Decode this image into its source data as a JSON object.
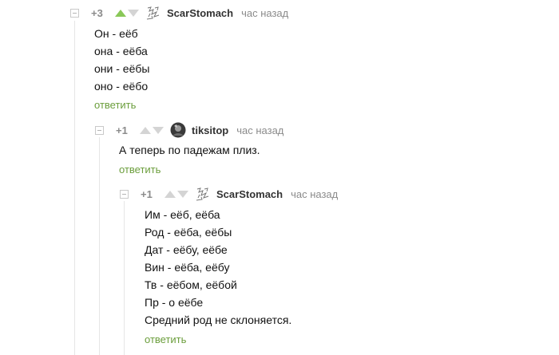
{
  "comments": [
    {
      "rating": "+3",
      "user": "ScarStomach",
      "time": "час назад",
      "lines": [
        "Он - еёб",
        "она - еёба",
        "они - еёбы",
        "оно - еёбо"
      ],
      "reply": "ответить",
      "upvote_active": true,
      "avatar_icon": "scribble-avatar-icon"
    },
    {
      "rating": "+1",
      "user": "tiksitop",
      "time": "час назад",
      "lines": [
        "А теперь по падежам плиз."
      ],
      "reply": "ответить",
      "upvote_active": false,
      "avatar_icon": "photo-avatar-icon"
    },
    {
      "rating": "+1",
      "user": "ScarStomach",
      "time": "час назад",
      "lines": [
        "Им - еёб, еёба",
        "Род - еёба, еёбы",
        "Дат - еёбу, еёбе",
        "Вин - еёба, еёбу",
        "Тв - еёбом, еёбой",
        "Пр - о еёбе",
        "Средний род не склоняется."
      ],
      "reply": "ответить",
      "upvote_active": false,
      "avatar_icon": "scribble-avatar-icon"
    }
  ],
  "colors": {
    "upvote_active": "#8ac858",
    "reply_link": "#6b9e3c",
    "muted": "#8b8b8b"
  }
}
